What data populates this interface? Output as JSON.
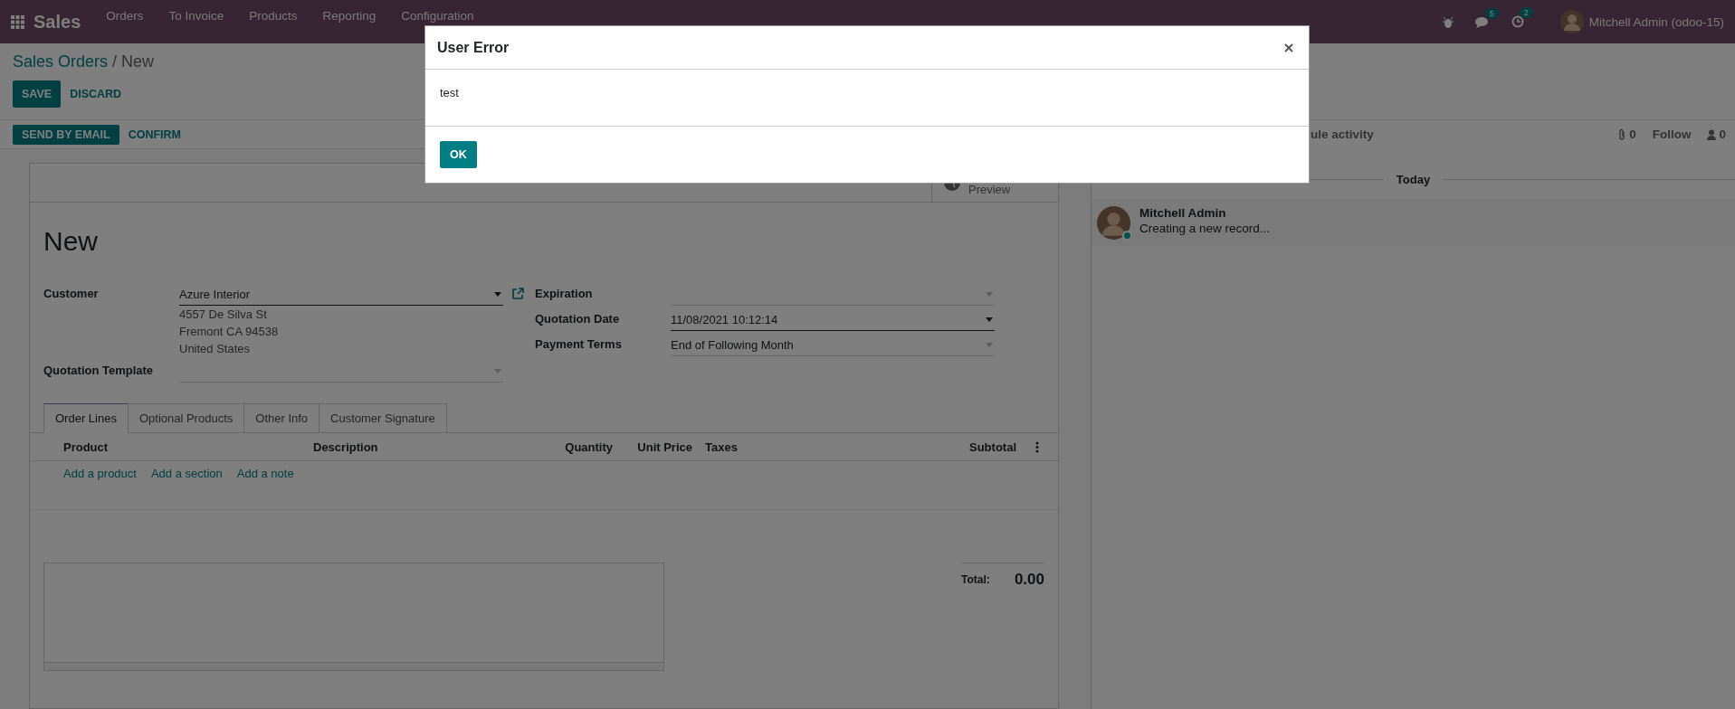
{
  "navbar": {
    "app": "Sales",
    "menus": [
      "Orders",
      "To Invoice",
      "Products",
      "Reporting",
      "Configuration"
    ],
    "message_count": "5",
    "activity_count": "2",
    "user": "Mitchell Admin (odoo-15)"
  },
  "breadcrumb": {
    "parent": "Sales Orders",
    "separator": "/",
    "current": "New"
  },
  "buttons": [
    {
      "label": "SAVE",
      "kind": "primary"
    },
    {
      "label": "DISCARD",
      "kind": "link"
    }
  ],
  "status_buttons": [
    {
      "label": "SEND BY EMAIL",
      "kind": "primary"
    },
    {
      "label": "CONFIRM",
      "kind": "link"
    }
  ],
  "stat_button": {
    "label": "Preview"
  },
  "record_title": "New",
  "left_fields": [
    {
      "label": "Customer",
      "value": "Azure Interior",
      "address": [
        "4557 De Silva St",
        "Fremont CA 94538",
        "United States"
      ],
      "focused": true
    },
    {
      "label": "Quotation Template",
      "focused": false
    }
  ],
  "right_fields": [
    {
      "label": "Expiration",
      "focused": false
    },
    {
      "label": "Quotation Date",
      "value": "11/08/2021 10:12:14",
      "focused": true
    },
    {
      "label": "Payment Terms",
      "value": "End of Following Month",
      "focused": false
    }
  ],
  "tabs": [
    {
      "label": "Order Lines",
      "selected": true
    },
    {
      "label": "Optional Products",
      "selected": false
    },
    {
      "label": "Other Info",
      "selected": false
    },
    {
      "label": "Customer Signature",
      "selected": false
    }
  ],
  "table": {
    "columns": [
      "Product",
      "Description",
      "Quantity",
      "Unit Price",
      "Taxes",
      "Subtotal"
    ]
  },
  "add_links": [
    "Add a product",
    "Add a section",
    "Add a note"
  ],
  "total": {
    "label": "Total:",
    "value": "0.00"
  },
  "chatter": {
    "cut_action": "ule activity",
    "attachments": "0",
    "follow": "Follow",
    "followers": "0",
    "separator": "Today",
    "messages": [
      {
        "author": "Mitchell Admin",
        "body": "Creating a new record...",
        "online": true
      }
    ]
  },
  "dialog": {
    "title": "User Error",
    "body": "test",
    "button": "OK"
  }
}
